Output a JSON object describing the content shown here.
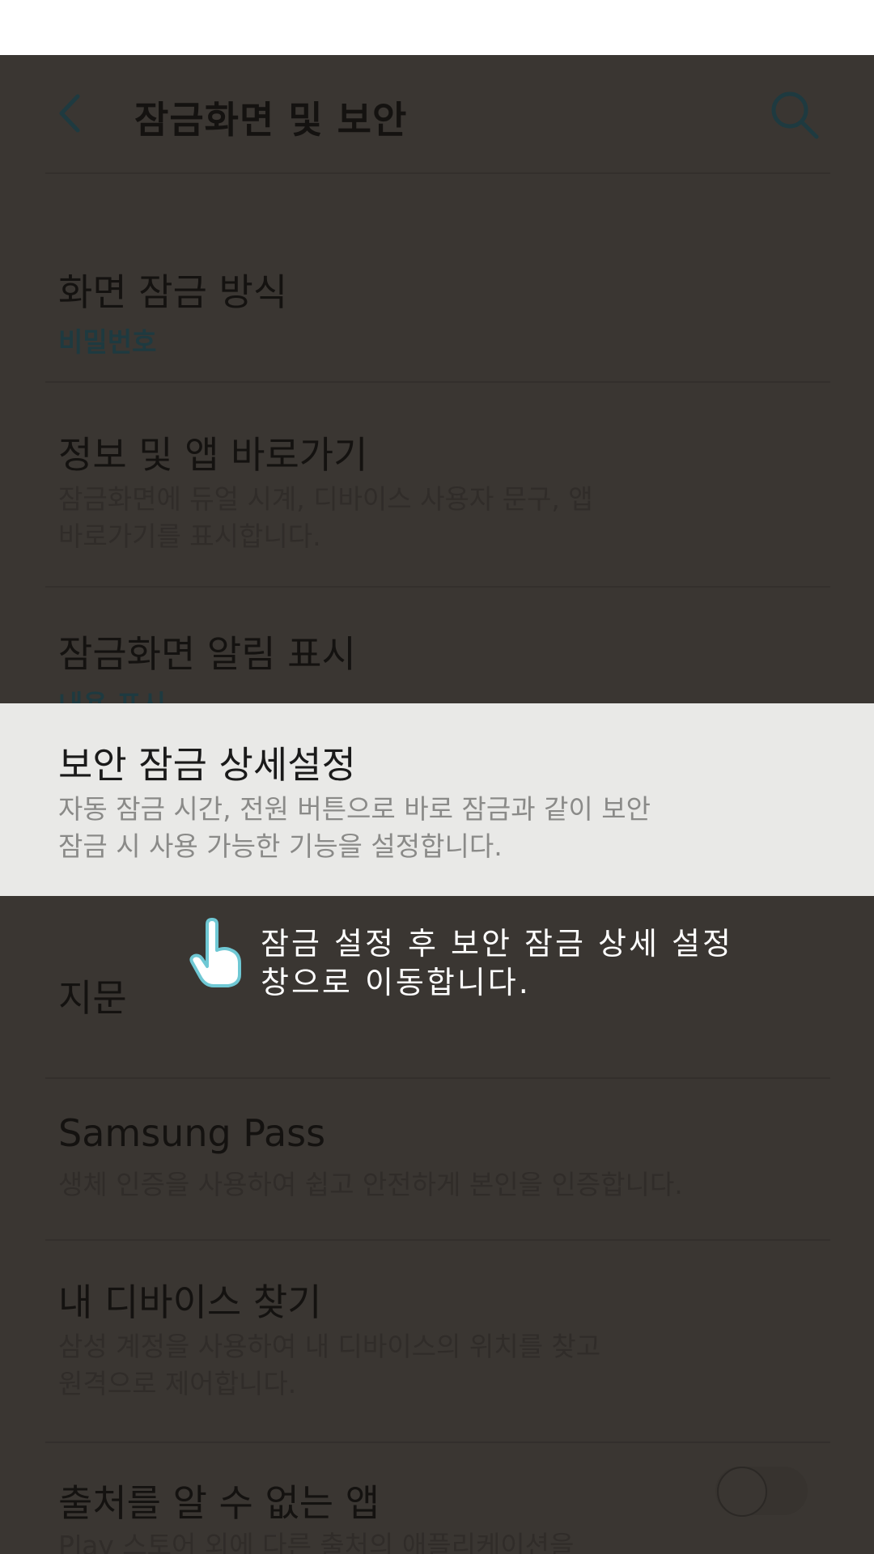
{
  "appbar": {
    "title": "잠금화면 및 보안",
    "back_icon": "chevron-left-icon",
    "search_icon": "search-icon"
  },
  "items": [
    {
      "title": "화면 잠금 방식",
      "subtitle": "비밀번호"
    },
    {
      "title": "정보 및 앱 바로가기",
      "description": "잠금화면에 듀얼 시계, 디바이스 사용자 문구, 앱\n바로가기를 표시합니다."
    },
    {
      "title": "잠금화면 알림 표시",
      "subtitle": "내용 표시"
    },
    {
      "title": "보안 잠금 상세설정",
      "description": "자동 잠금 시간, 전원 버튼으로 바로 잠금과 같이 보안\n잠금 시 사용 가능한 기능을 설정합니다."
    },
    {
      "title": "지문"
    },
    {
      "title": "Samsung Pass",
      "description": "생체 인증을 사용하여 쉽고 안전하게 본인을 인증합니다."
    },
    {
      "title": "내 디바이스 찾기",
      "description": "삼성 계정을 사용하여 내 디바이스의 위치를 찾고\n원격으로 제어합니다."
    },
    {
      "title": "출처를 알 수 없는 앱",
      "description": "Play 스토어 외에 다른 출처의 애플리케이션을\n설치할 수 있도록 허용합니다.",
      "toggle_on": false
    }
  ],
  "callout": {
    "text": "잠금 설정 후 보안 잠금 상세 설정\n창으로 이동합니다.",
    "icon": "tap-hand-icon"
  },
  "colors": {
    "dim_background": "#3a3632",
    "highlight_background": "#e9e9e7",
    "accent": "#1e3a40",
    "callout_text": "#ffffff"
  }
}
